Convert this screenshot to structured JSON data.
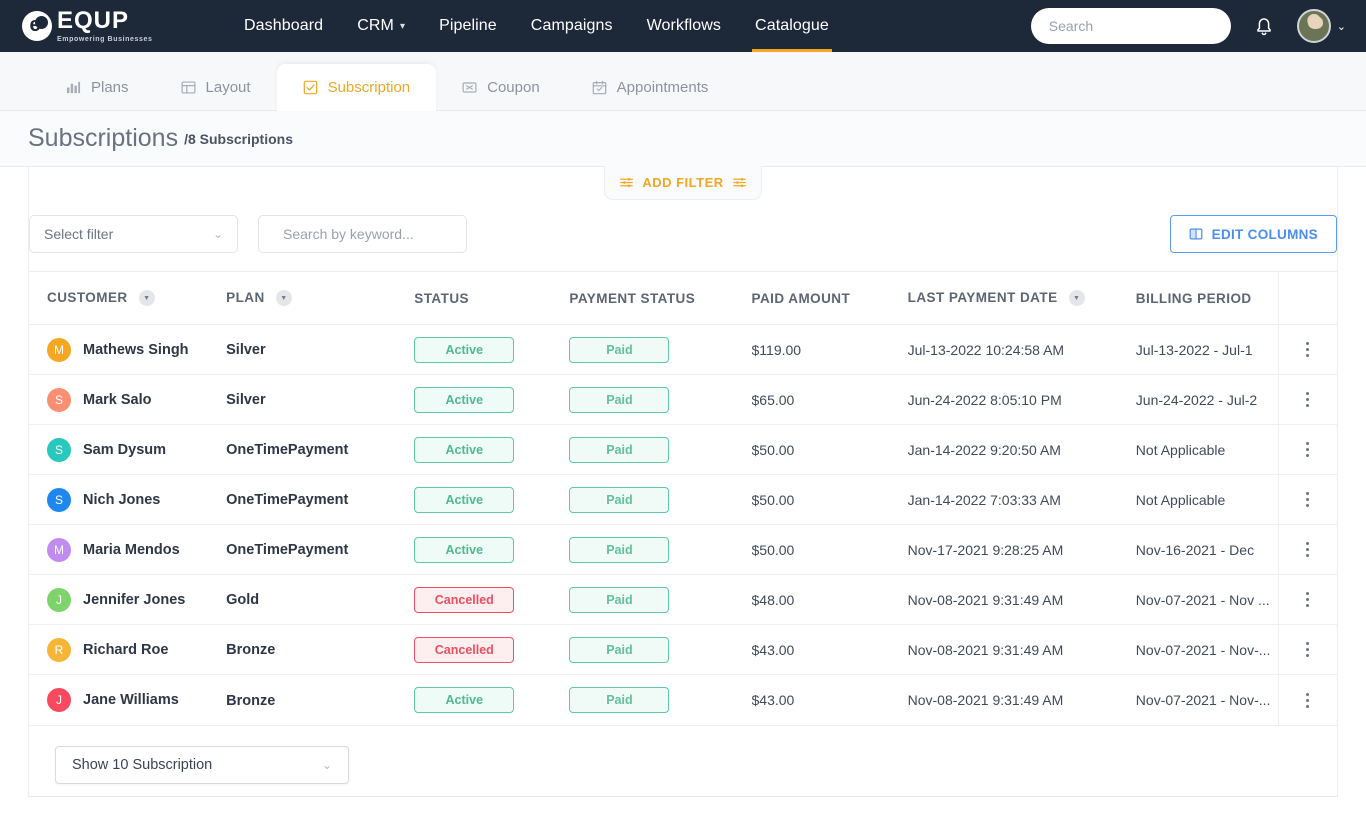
{
  "brand": {
    "name": "EQUP",
    "tagline": "Empowering Businesses",
    "logo_icon": "equp-logo-icon"
  },
  "topnav": {
    "links": [
      {
        "label": "Dashboard",
        "has_caret": false,
        "active": false
      },
      {
        "label": "CRM",
        "has_caret": true,
        "active": false
      },
      {
        "label": "Pipeline",
        "has_caret": false,
        "active": false
      },
      {
        "label": "Campaigns",
        "has_caret": false,
        "active": false
      },
      {
        "label": "Workflows",
        "has_caret": false,
        "active": false
      },
      {
        "label": "Catalogue",
        "has_caret": false,
        "active": true
      }
    ],
    "search": {
      "value": "",
      "placeholder": "Search",
      "icon": "search-icon"
    },
    "notification_icon": "bell-icon",
    "avatar_caret": "⌄",
    "active_accent": "#f5a623"
  },
  "tabs": [
    {
      "label": "Plans",
      "icon": "bar-chart-icon",
      "active": false
    },
    {
      "label": "Layout",
      "icon": "layout-icon",
      "active": false
    },
    {
      "label": "Subscription",
      "icon": "checkbox-icon",
      "active": true
    },
    {
      "label": "Coupon",
      "icon": "coupon-icon",
      "active": false
    },
    {
      "label": "Appointments",
      "icon": "calendar-icon",
      "active": false
    }
  ],
  "page": {
    "title": "Subscriptions",
    "subtitle": "/8 Subscriptions"
  },
  "toolbar": {
    "add_filter_label": "ADD FILTER",
    "add_filter_icon": "sliders-icon",
    "select_filter_label": "Select filter",
    "keyword_value": "",
    "keyword_placeholder": "Search by keyword...",
    "keyword_icon": "search-icon",
    "edit_columns_label": "EDIT COLUMNS",
    "edit_columns_icon": "columns-icon",
    "edit_columns_color": "#4a8ef0"
  },
  "table": {
    "columns": [
      {
        "label": "CUSTOMER",
        "sortable": true
      },
      {
        "label": "PLAN",
        "sortable": true
      },
      {
        "label": "STATUS",
        "sortable": false
      },
      {
        "label": "PAYMENT STATUS",
        "sortable": false
      },
      {
        "label": "PAID AMOUNT",
        "sortable": false
      },
      {
        "label": "LAST PAYMENT DATE",
        "sortable": true
      },
      {
        "label": "BILLING PERIOD",
        "sortable": false
      }
    ],
    "rows": [
      {
        "initial": "M",
        "color": "#f5a623",
        "customer": "Mathews Singh",
        "plan": "Silver",
        "status": "Active",
        "status_type": "green",
        "payment_status": "Paid",
        "paid_amount": "$119.00",
        "last_payment_date": "Jul-13-2022 10:24:58 AM",
        "billing_period": "Jul-13-2022 - Jul-1"
      },
      {
        "initial": "S",
        "color": "#fb8f73",
        "customer": "Mark Salo",
        "plan": "Silver",
        "status": "Active",
        "status_type": "green",
        "payment_status": "Paid",
        "paid_amount": "$65.00",
        "last_payment_date": "Jun-24-2022 8:05:10 PM",
        "billing_period": "Jun-24-2022 - Jul-2"
      },
      {
        "initial": "S",
        "color": "#29c8bd",
        "customer": "Sam Dysum",
        "plan": "OneTimePayment",
        "status": "Active",
        "status_type": "green",
        "payment_status": "Paid",
        "paid_amount": "$50.00",
        "last_payment_date": "Jan-14-2022 9:20:50 AM",
        "billing_period": "Not Applicable"
      },
      {
        "initial": "S",
        "color": "#1e88f0",
        "customer": "Nich Jones",
        "plan": "OneTimePayment",
        "status": "Active",
        "status_type": "green",
        "payment_status": "Paid",
        "paid_amount": "$50.00",
        "last_payment_date": "Jan-14-2022 7:03:33 AM",
        "billing_period": "Not Applicable"
      },
      {
        "initial": "M",
        "color": "#c18cf0",
        "customer": "Maria Mendos",
        "plan": "OneTimePayment",
        "status": "Active",
        "status_type": "green",
        "payment_status": "Paid",
        "paid_amount": "$50.00",
        "last_payment_date": "Nov-17-2021 9:28:25 AM",
        "billing_period": "Nov-16-2021 - Dec"
      },
      {
        "initial": "J",
        "color": "#7ed36a",
        "customer": "Jennifer Jones",
        "plan": "Gold",
        "status": "Cancelled",
        "status_type": "red",
        "payment_status": "Paid",
        "paid_amount": "$48.00",
        "last_payment_date": "Nov-08-2021 9:31:49 AM",
        "billing_period": "Nov-07-2021 - Nov ..."
      },
      {
        "initial": "R",
        "color": "#f5b638",
        "customer": "Richard Roe",
        "plan": "Bronze",
        "status": "Cancelled",
        "status_type": "red",
        "payment_status": "Paid",
        "paid_amount": "$43.00",
        "last_payment_date": "Nov-08-2021 9:31:49 AM",
        "billing_period": "Nov-07-2021 - Nov-..."
      },
      {
        "initial": "J",
        "color": "#f9495f",
        "customer": "Jane Williams",
        "plan": "Bronze",
        "status": "Active",
        "status_type": "green",
        "payment_status": "Paid",
        "paid_amount": "$43.00",
        "last_payment_date": "Nov-08-2021 9:31:49 AM",
        "billing_period": "Nov-07-2021 - Nov-..."
      }
    ],
    "row_menu_icon": "kebab-menu-icon"
  },
  "footer": {
    "show_label": "Show 10 Subscription"
  }
}
